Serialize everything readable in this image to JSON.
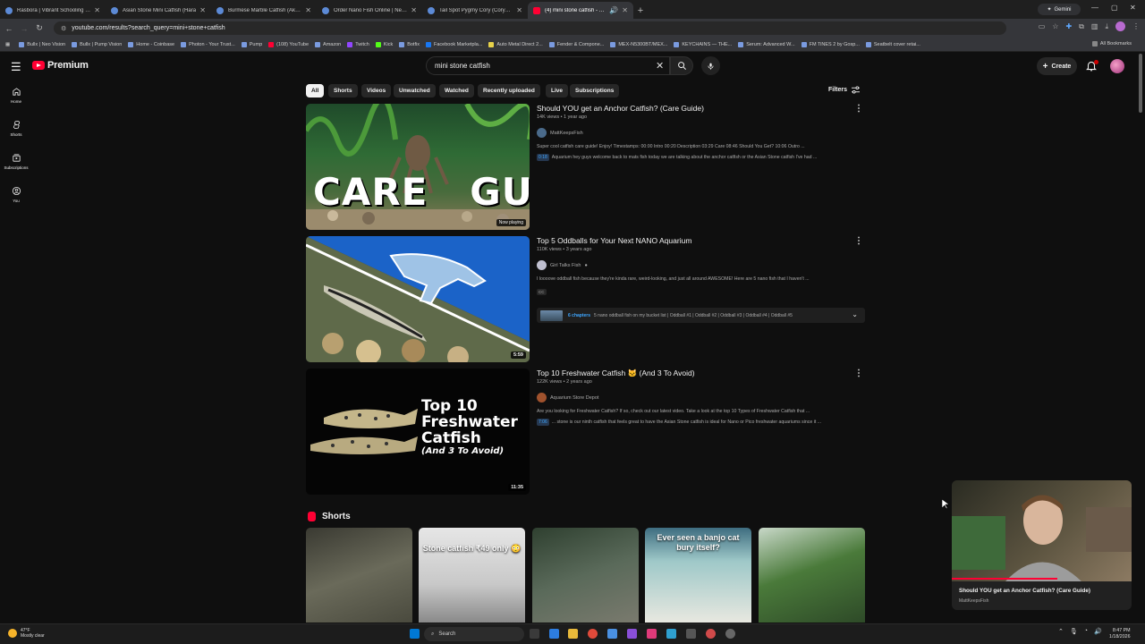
{
  "browser": {
    "tabs": [
      {
        "title": "Rasbora | Vibrant Schooling Fis"
      },
      {
        "title": "Asian Stone Mini Catfish (Hara"
      },
      {
        "title": "Burmese Marble Catfish (Akysi"
      },
      {
        "title": "Order Nano Fish Online | Next-"
      },
      {
        "title": "Tail Spot Pygmy Cory (Corydor"
      },
      {
        "title": "(4) mini stone catfish - YouT"
      }
    ],
    "gemini_label": "Gemini",
    "url": "youtube.com/results?search_query=mini+stone+catfish",
    "bookmarks": [
      "Bullx | Neo Vision",
      "Bullx | Pump Vision",
      "Home - Coinbase",
      "Photon - Your Trust...",
      "Pump",
      "(108) YouTube",
      "Amazon",
      "Twitch",
      "Kick",
      "Botfix",
      "Facebook Marketpla...",
      "Auto Metal Direct 2...",
      "Fender & Compone...",
      "MEX-N5300BT/MEX...",
      "KEYCHAINS — THE...",
      "Serum: Advanced W...",
      "FM TiNES 2 by Gosp...",
      "Seatbelt cover retai..."
    ],
    "all_bookmarks": "All Bookmarks"
  },
  "yt": {
    "brand": "Premium",
    "search_query": "mini stone catfish",
    "create_label": "Create",
    "notification_count": "4",
    "guide": [
      {
        "label": "Home"
      },
      {
        "label": "Shorts"
      },
      {
        "label": "Subscriptions"
      },
      {
        "label": "You"
      }
    ],
    "chips": [
      "All",
      "Shorts",
      "Videos",
      "Unwatched",
      "Watched",
      "Recently uploaded",
      "Live",
      "Subscriptions"
    ],
    "filters_label": "Filters",
    "results": [
      {
        "title": "Should YOU get an Anchor Catfish? (Care Guide)",
        "stats": "14K views • 1 year ago",
        "channel": "MattKeepsFish",
        "description": "Super cool catfish care guide! Enjoy! Timestamps: 00:00 Intro 00:20 Description 03:29 Care 08:46 Should You Get? 10:06 Outro ...",
        "snippet_time": "0:18",
        "snippet": "Aquarium hey guys welcome back to mats fish today we are talking about the anchor catfish or the Asian Stone catfish I've had ...",
        "badge": "Now playing",
        "thumb_text": "CARE   GUIDE"
      },
      {
        "title": "Top 5 Oddballs for Your Next NANO Aquarium",
        "stats": "110K views • 3 years ago",
        "channel": "Girl Talks Fish",
        "description": "I loooove oddball fish because they're kinda rare, weird-looking, and just all around AWESOME! Here are 5 nano fish that I haven't ...",
        "cc": "CC",
        "chapters_count": "6 chapters",
        "chapters_text": "5 nano oddball fish on my bucket list | Oddball #1 | Oddball #2 | Oddball #3 | Oddball #4 | Oddball #5",
        "duration": "5:59"
      },
      {
        "title": "Top 10 Freshwater Catfish 🐱 (And 3 To Avoid)",
        "stats": "122K views • 2 years ago",
        "channel": "Aquarium Store Depot",
        "description": "Are you looking for Freshwater Catfish? If so, check out our latest video. Take a look at the top 10 Types of Freshwater Catfish that ...",
        "snippet_time": "7:06",
        "snippet": "... stone is our ninth catfish that feels great to have the Asian Stone catfish is ideal for Nano or Pico freshwater aquariums since it ...",
        "duration": "11:35",
        "thumb_line1": "Top 10",
        "thumb_line2": "Freshwater",
        "thumb_line3": "Catfish",
        "thumb_line4": "(And 3 To Avoid)"
      }
    ],
    "shorts_heading": "Shorts",
    "shorts": [
      {
        "caption": ""
      },
      {
        "caption": "Stone catfish ₹49 only 😳"
      },
      {
        "caption": ""
      },
      {
        "caption": "Ever seen a banjo cat bury itself?"
      },
      {
        "caption": ""
      }
    ],
    "miniplayer": {
      "title": "Should YOU get an Anchor Catfish? (Care Guide)",
      "channel": "MattKeepsFish"
    }
  },
  "taskbar": {
    "temp": "47°F",
    "weather": "Mostly clear",
    "search_label": "Search",
    "time": "8:47 PM",
    "date": "1/18/2026"
  },
  "colors": {
    "yt_red": "#ff0033",
    "background": "#0f0f0f",
    "link_blue": "#3ea6ff"
  }
}
